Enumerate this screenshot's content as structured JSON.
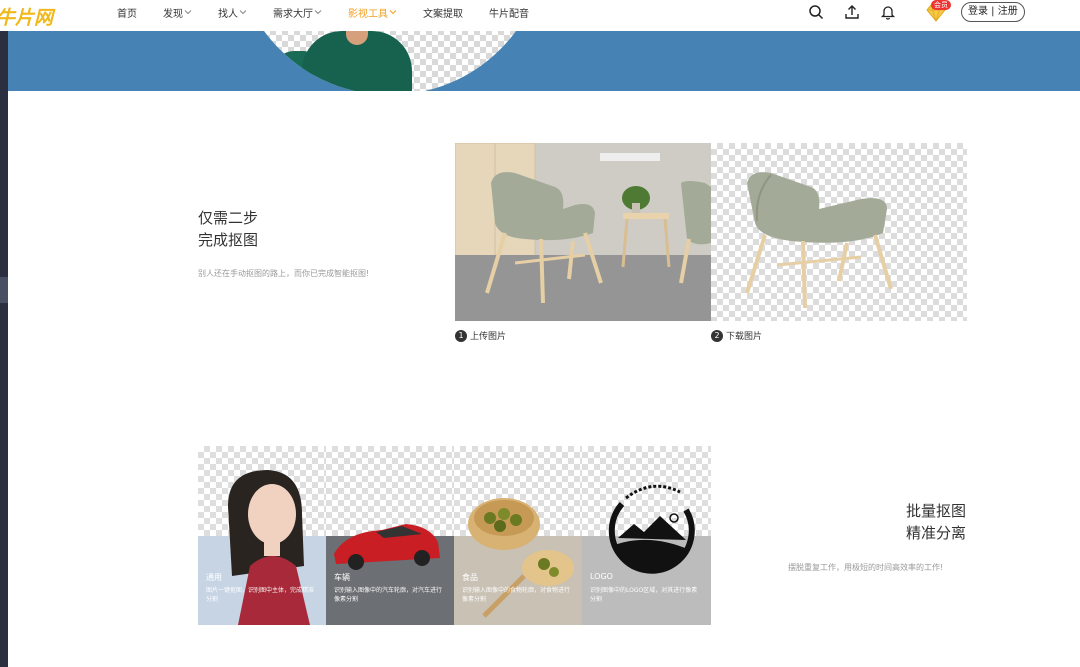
{
  "topbar": {
    "logo_text": "牛片网",
    "nav": [
      {
        "label": "首页",
        "has_dropdown": false,
        "active": false
      },
      {
        "label": "发现",
        "has_dropdown": true,
        "active": false
      },
      {
        "label": "找人",
        "has_dropdown": true,
        "active": false
      },
      {
        "label": "需求大厅",
        "has_dropdown": true,
        "active": false
      },
      {
        "label": "影视工具",
        "has_dropdown": true,
        "active": true
      },
      {
        "label": "文案提取",
        "has_dropdown": false,
        "active": false
      },
      {
        "label": "牛片配音",
        "has_dropdown": false,
        "active": false
      }
    ],
    "icons": [
      "search-icon",
      "upload-icon",
      "bell-icon",
      "vip-diamond-icon"
    ],
    "vip_badge": "会员",
    "login_label": "登录 | 注册"
  },
  "section_two_steps": {
    "title_line1": "仅需二步",
    "title_line2": "完成抠图",
    "description": "别人还在手动抠图的路上，而你已完成智能抠图!",
    "steps": [
      {
        "number": "1",
        "label": "上传图片"
      },
      {
        "number": "2",
        "label": "下载图片"
      }
    ]
  },
  "section_batch": {
    "title_line1": "批量抠图",
    "title_line2": "精准分离",
    "description": "摆脱重复工作，用极短的时间高效率的工作!",
    "categories": [
      {
        "title": "通用",
        "desc": "图片一键抠图，识别图中主体，完成精准分割"
      },
      {
        "title": "车辆",
        "desc": "识别输入图像中的汽车轮廓，对汽车进行像素分割"
      },
      {
        "title": "食品",
        "desc": "识别输入图像中的食物轮廓，对食物进行像素分割"
      },
      {
        "title": "LOGO",
        "desc": "识别图像中的LOGO区域，对其进行像素分割"
      }
    ]
  },
  "colors": {
    "banner_blue": "#4682b4",
    "accent_orange": "#f0a020",
    "logo_yellow": "#f0b81b",
    "shirt_green": "#17624f"
  }
}
